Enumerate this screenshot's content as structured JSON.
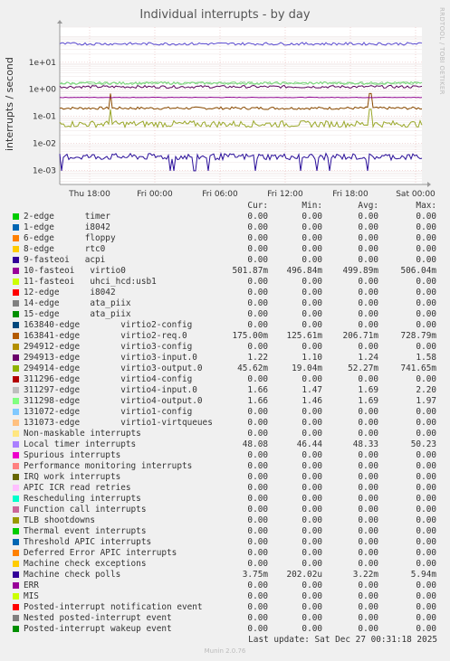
{
  "title": "Individual interrupts - by day",
  "watermark": "RRDTOOL / TOBI OETIKER",
  "ylabel": "interrupts / second",
  "chart_data": {
    "type": "line",
    "yscale": "log",
    "ylim": [
      0.0003,
      200
    ],
    "ytick_labels": [
      "1e+01",
      "1e+00",
      "1e-01",
      "1e-02",
      "1e-03"
    ],
    "ytick_values": [
      10,
      1,
      0.1,
      0.01,
      0.001
    ],
    "xtick_labels": [
      "Thu 18:00",
      "Fri 00:00",
      "Fri 06:00",
      "Fri 12:00",
      "Fri 18:00",
      "Sat 00:00"
    ],
    "series": [
      {
        "name": "163841-edge virtio2-req.0",
        "color": "#8a4b00",
        "approx": 0.2
      },
      {
        "name": "10-fasteoi virtio0",
        "color": "#8c008c",
        "approx": 0.5
      },
      {
        "name": "294913-edge virtio3-input.0",
        "color": "#5a005a",
        "approx": 1.24
      },
      {
        "name": "311297-edge virtio4-input.0",
        "color": "#9fd0a0",
        "approx": 1.69
      },
      {
        "name": "311298-edge virtio4-output.0",
        "color": "#7cd97c",
        "approx": 1.69
      },
      {
        "name": "294914-edge virtio3-output.0",
        "color": "#9aa82a",
        "approx": 0.052
      },
      {
        "name": "Machine check polls",
        "color": "#2a0f9a",
        "approx": 0.0032
      },
      {
        "name": "Local timer interrupts",
        "color": "#5a4ad0",
        "approx": 48.3
      }
    ]
  },
  "legend": {
    "headers": {
      "cur": "Cur:",
      "min": "Min:",
      "avg": "Avg:",
      "max": "Max:"
    },
    "rows": [
      {
        "label": "2-edge      timer",
        "color": "#00cc00",
        "cur": "0.00",
        "min": "0.00",
        "avg": "0.00",
        "max": "0.00"
      },
      {
        "label": "1-edge      i8042",
        "color": "#0066b3",
        "cur": "0.00",
        "min": "0.00",
        "avg": "0.00",
        "max": "0.00"
      },
      {
        "label": "6-edge      floppy",
        "color": "#ff8000",
        "cur": "0.00",
        "min": "0.00",
        "avg": "0.00",
        "max": "0.00"
      },
      {
        "label": "8-edge      rtc0",
        "color": "#ffcc00",
        "cur": "0.00",
        "min": "0.00",
        "avg": "0.00",
        "max": "0.00"
      },
      {
        "label": "9-fasteoi   acpi",
        "color": "#330099",
        "cur": "0.00",
        "min": "0.00",
        "avg": "0.00",
        "max": "0.00"
      },
      {
        "label": "10-fasteoi   virtio0",
        "color": "#990099",
        "cur": "501.87m",
        "min": "496.84m",
        "avg": "499.89m",
        "max": "506.04m"
      },
      {
        "label": "11-fasteoi   uhci_hcd:usb1",
        "color": "#ccff00",
        "cur": "0.00",
        "min": "0.00",
        "avg": "0.00",
        "max": "0.00"
      },
      {
        "label": "12-edge      i8042",
        "color": "#ff0000",
        "cur": "0.00",
        "min": "0.00",
        "avg": "0.00",
        "max": "0.00"
      },
      {
        "label": "14-edge      ata_piix",
        "color": "#808080",
        "cur": "0.00",
        "min": "0.00",
        "avg": "0.00",
        "max": "0.00"
      },
      {
        "label": "15-edge      ata_piix",
        "color": "#008f00",
        "cur": "0.00",
        "min": "0.00",
        "avg": "0.00",
        "max": "0.00"
      },
      {
        "label": "163840-edge        virtio2-config",
        "color": "#00487d",
        "cur": "0.00",
        "min": "0.00",
        "avg": "0.00",
        "max": "0.00"
      },
      {
        "label": "163841-edge        virtio2-req.0",
        "color": "#b35a00",
        "cur": "175.00m",
        "min": "125.61m",
        "avg": "206.71m",
        "max": "728.79m"
      },
      {
        "label": "294912-edge        virtio3-config",
        "color": "#b38f00",
        "cur": "0.00",
        "min": "0.00",
        "avg": "0.00",
        "max": "0.00"
      },
      {
        "label": "294913-edge        virtio3-input.0",
        "color": "#6b006b",
        "cur": "1.22",
        "min": "1.10",
        "avg": "1.24",
        "max": "1.58"
      },
      {
        "label": "294914-edge        virtio3-output.0",
        "color": "#8fb300",
        "cur": "45.62m",
        "min": "19.04m",
        "avg": "52.27m",
        "max": "741.65m"
      },
      {
        "label": "311296-edge        virtio4-config",
        "color": "#b30000",
        "cur": "0.00",
        "min": "0.00",
        "avg": "0.00",
        "max": "0.00"
      },
      {
        "label": "311297-edge        virtio4-input.0",
        "color": "#bebebe",
        "cur": "1.66",
        "min": "1.47",
        "avg": "1.69",
        "max": "2.20"
      },
      {
        "label": "311298-edge        virtio4-output.0",
        "color": "#80ff80",
        "cur": "1.66",
        "min": "1.46",
        "avg": "1.69",
        "max": "1.97"
      },
      {
        "label": "131072-edge        virtio1-config",
        "color": "#80c9ff",
        "cur": "0.00",
        "min": "0.00",
        "avg": "0.00",
        "max": "0.00"
      },
      {
        "label": "131073-edge        virtio1-virtqueues",
        "color": "#ffc080",
        "cur": "0.00",
        "min": "0.00",
        "avg": "0.00",
        "max": "0.00"
      },
      {
        "label": "Non-maskable interrupts",
        "color": "#ffe680",
        "cur": "0.00",
        "min": "0.00",
        "avg": "0.00",
        "max": "0.00"
      },
      {
        "label": "Local timer interrupts",
        "color": "#aa80ff",
        "cur": "48.08",
        "min": "46.44",
        "avg": "48.33",
        "max": "50.23"
      },
      {
        "label": "Spurious interrupts",
        "color": "#ee00cc",
        "cur": "0.00",
        "min": "0.00",
        "avg": "0.00",
        "max": "0.00"
      },
      {
        "label": "Performance monitoring interrupts",
        "color": "#ff8080",
        "cur": "0.00",
        "min": "0.00",
        "avg": "0.00",
        "max": "0.00"
      },
      {
        "label": "IRQ work interrupts",
        "color": "#666600",
        "cur": "0.00",
        "min": "0.00",
        "avg": "0.00",
        "max": "0.00"
      },
      {
        "label": "APIC ICR read retries",
        "color": "#ffbfff",
        "cur": "0.00",
        "min": "0.00",
        "avg": "0.00",
        "max": "0.00"
      },
      {
        "label": "Rescheduling interrupts",
        "color": "#00ffcc",
        "cur": "0.00",
        "min": "0.00",
        "avg": "0.00",
        "max": "0.00"
      },
      {
        "label": "Function call interrupts",
        "color": "#cc6699",
        "cur": "0.00",
        "min": "0.00",
        "avg": "0.00",
        "max": "0.00"
      },
      {
        "label": "TLB shootdowns",
        "color": "#999900",
        "cur": "0.00",
        "min": "0.00",
        "avg": "0.00",
        "max": "0.00"
      },
      {
        "label": "Thermal event interrupts",
        "color": "#00cc00",
        "cur": "0.00",
        "min": "0.00",
        "avg": "0.00",
        "max": "0.00"
      },
      {
        "label": "Threshold APIC interrupts",
        "color": "#0066b3",
        "cur": "0.00",
        "min": "0.00",
        "avg": "0.00",
        "max": "0.00"
      },
      {
        "label": "Deferred Error APIC interrupts",
        "color": "#ff8000",
        "cur": "0.00",
        "min": "0.00",
        "avg": "0.00",
        "max": "0.00"
      },
      {
        "label": "Machine check exceptions",
        "color": "#ffcc00",
        "cur": "0.00",
        "min": "0.00",
        "avg": "0.00",
        "max": "0.00"
      },
      {
        "label": "Machine check polls",
        "color": "#330099",
        "cur": "3.75m",
        "min": "202.02u",
        "avg": "3.22m",
        "max": "5.94m"
      },
      {
        "label": "ERR",
        "color": "#990099",
        "cur": "0.00",
        "min": "0.00",
        "avg": "0.00",
        "max": "0.00"
      },
      {
        "label": "MIS",
        "color": "#ccff00",
        "cur": "0.00",
        "min": "0.00",
        "avg": "0.00",
        "max": "0.00"
      },
      {
        "label": "Posted-interrupt notification event",
        "color": "#ff0000",
        "cur": "0.00",
        "min": "0.00",
        "avg": "0.00",
        "max": "0.00"
      },
      {
        "label": "Nested posted-interrupt event",
        "color": "#808080",
        "cur": "0.00",
        "min": "0.00",
        "avg": "0.00",
        "max": "0.00"
      },
      {
        "label": "Posted-interrupt wakeup event",
        "color": "#008f00",
        "cur": "0.00",
        "min": "0.00",
        "avg": "0.00",
        "max": "0.00"
      }
    ]
  },
  "last_update": "Last update: Sat Dec 27 00:31:18 2025",
  "munin": "Munin 2.0.76"
}
